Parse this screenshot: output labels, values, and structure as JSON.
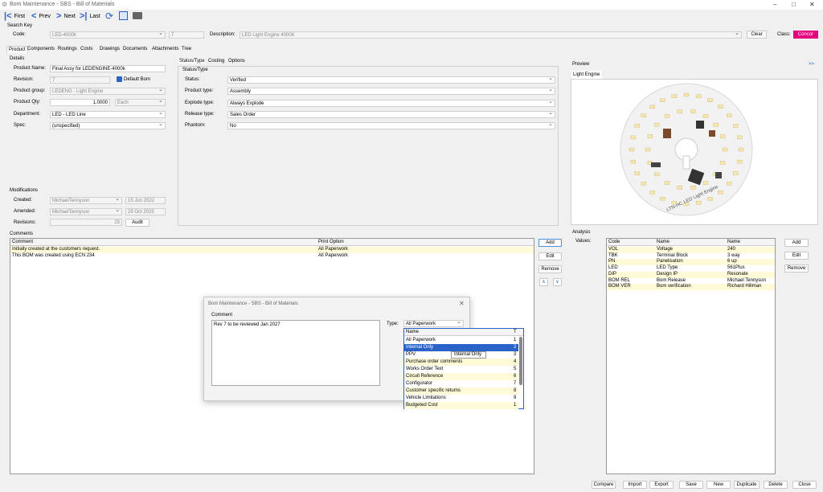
{
  "window": {
    "title": "Bom Maintenance - SBS - Bill of Materials",
    "min": "–",
    "max": "□",
    "close": "✕"
  },
  "toolbar": {
    "first": "First",
    "prev": "Prev",
    "next": "Next",
    "last": "Last"
  },
  "search": {
    "group": "Search Key",
    "code_label": "Code:",
    "code": "LED-4000k",
    "rev": "7",
    "desc_label": "Description:",
    "desc": "LED Light Engine 4000K",
    "clear": "Clear",
    "class_label": "Class:",
    "class": "Concor",
    "class_color": "#e6007e"
  },
  "tabs": [
    "Product",
    "Components",
    "Routings",
    "Costs",
    "Drawings",
    "Documents",
    "Attachments",
    "Tree"
  ],
  "details": {
    "group": "Details",
    "name_label": "Product Name:",
    "name": "Final Assy for LEDENGINE-4000k",
    "rev_label": "Revision:",
    "rev": "7",
    "default_bom": "Default Bom",
    "pgroup_label": "Product group:",
    "pgroup": "LEDENG - Light Engine",
    "qty_label": "Product Qty:",
    "qty": "1.0000",
    "unit": "Each",
    "dept_label": "Department:",
    "dept": "LED - LED Line",
    "spec_label": "Spec:",
    "spec": "(unspecified)"
  },
  "mods": {
    "group": "Modifications",
    "created_label": "Created:",
    "created_by": "MichaelTennyson",
    "created_date": "15 Jun 2022",
    "amended_label": "Amended:",
    "amended_by": "MichaelTennyson",
    "amended_date": "29 Oct 2025",
    "revisions_label": "Revisions:",
    "revisions": "25",
    "audit": "Audit"
  },
  "status_tabs": [
    "Status/Type",
    "Costing",
    "Options"
  ],
  "status": {
    "group": "Status/Type",
    "fields": [
      {
        "label": "Status:",
        "value": "Verified"
      },
      {
        "label": "Product type:",
        "value": "Assembly"
      },
      {
        "label": "Explode type:",
        "value": "Always Explode"
      },
      {
        "label": "Release type:",
        "value": "Sales Order"
      },
      {
        "label": "Phantom:",
        "value": "No"
      }
    ]
  },
  "preview": {
    "group": "Preview",
    "expand": ">>",
    "tab": "Light Engine",
    "pcb_text": "LTN-HC LED Light Engine"
  },
  "comments": {
    "group": "Comments",
    "col1": "Comment",
    "col2": "Print Option",
    "rows": [
      {
        "c": "Initially created at the customers request.",
        "p": "All Paperwork"
      },
      {
        "c": "This BOM was created using ECN 234",
        "p": "All Paperwork"
      }
    ],
    "add": "Add",
    "edit": "Edit",
    "remove": "Remove"
  },
  "analysis": {
    "group": "Analysis",
    "values_label": "Values:",
    "cols": [
      "Code",
      "Name",
      "Name"
    ],
    "rows": [
      [
        "VOL",
        "Voltage",
        "240"
      ],
      [
        "TBK",
        "Terminal Block",
        "3 way"
      ],
      [
        "PN",
        "Panelisation",
        "6 up"
      ],
      [
        "LED",
        "LED Type",
        "561Plus"
      ],
      [
        "DIP",
        "Design IP",
        "Resonate"
      ],
      [
        "BOM REL",
        "Bom Release",
        "Michael Tennyson"
      ],
      [
        "BOM VER",
        "Bom verification",
        "Richard Hillman"
      ]
    ],
    "add": "Add",
    "edit": "Edit",
    "remove": "Remove"
  },
  "dialog": {
    "title": "Bom Maintenance - SBS - Bill of Materials",
    "comment_label": "Comment",
    "comment": "Rev 7 to be reviewed Jan 2027",
    "type_label": "Type:",
    "type": "All Paperwork",
    "list_header": "Name",
    "list_header2": "T",
    "tooltip": "Internal Only",
    "items": [
      [
        "All Paperwork",
        "1"
      ],
      [
        "Internal Only",
        "2"
      ],
      [
        "PPV",
        "3"
      ],
      [
        "Purchase order comments",
        "4"
      ],
      [
        "Works Order Text",
        "5"
      ],
      [
        "Circuit Reference",
        "6"
      ],
      [
        "Configurator",
        "7"
      ],
      [
        "Customer specific returns",
        "8"
      ],
      [
        "Vehicle Limitations",
        "9"
      ],
      [
        "Budgeted Cost",
        "1"
      ]
    ]
  },
  "bottom": [
    "Compare",
    "Import",
    "Export",
    "Save",
    "New",
    "Duplicate",
    "Delete",
    "Close"
  ]
}
